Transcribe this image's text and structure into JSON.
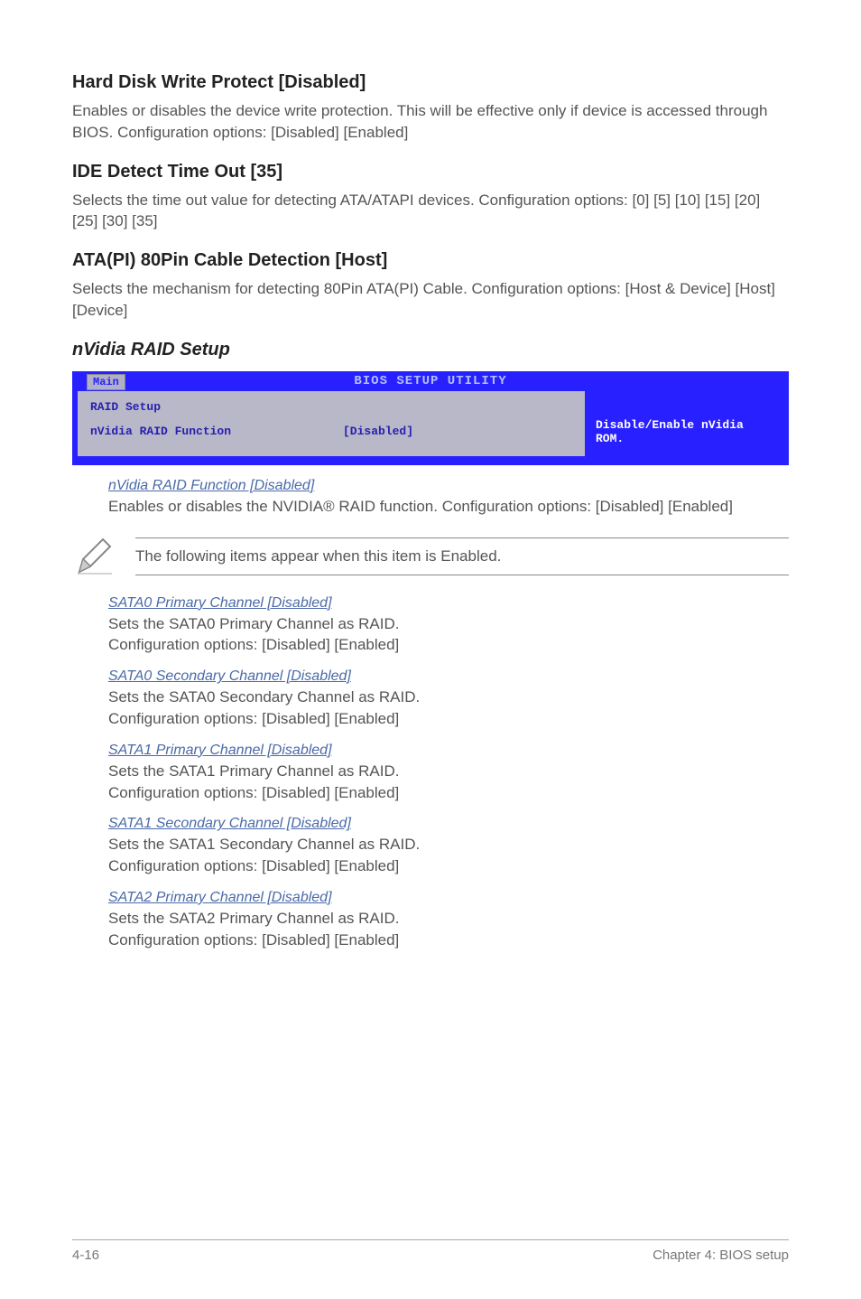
{
  "sections": {
    "s1": {
      "title": "Hard Disk Write Protect [Disabled]",
      "body": "Enables or disables the device write protection. This will be effective only if device is accessed through BIOS. Configuration options: [Disabled] [Enabled]"
    },
    "s2": {
      "title": "IDE Detect Time Out [35]",
      "body": "Selects the time out value for detecting ATA/ATAPI devices. Configuration options: [0] [5] [10] [15] [20] [25] [30] [35]"
    },
    "s3": {
      "title": "ATA(PI) 80Pin Cable Detection [Host]",
      "body": "Selects the mechanism for detecting 80Pin ATA(PI) Cable. Configuration options: [Host & Device] [Host] [Device]"
    }
  },
  "nvidia_heading": "nVidia RAID Setup",
  "bios": {
    "title": "BIOS SETUP UTILITY",
    "tab": "Main",
    "left_row1": "RAID Setup",
    "left_row2_label": "nVidia RAID Function",
    "left_row2_value": "[Disabled]",
    "right_text": "Disable/Enable nVidia ROM."
  },
  "raid_func": {
    "title": "nVidia RAID Function  [Disabled]",
    "body": "Enables or disables the NVIDIA® RAID function. Configuration options: [Disabled] [Enabled]"
  },
  "note": "The following items appear when this item is Enabled.",
  "sata": {
    "i1": {
      "t": "SATA0 Primary Channel [Disabled]",
      "b1": "Sets the SATA0 Primary Channel as RAID.",
      "b2": "Configuration options: [Disabled] [Enabled]"
    },
    "i2": {
      "t": "SATA0 Secondary Channel [Disabled]",
      "b1": "Sets the SATA0 Secondary Channel as RAID.",
      "b2": "Configuration options: [Disabled] [Enabled]"
    },
    "i3": {
      "t": "SATA1 Primary Channel [Disabled]",
      "b1": "Sets the SATA1 Primary Channel as RAID.",
      "b2": "Configuration options: [Disabled] [Enabled]"
    },
    "i4": {
      "t": "SATA1 Secondary Channel [Disabled]",
      "b1": "Sets the SATA1 Secondary Channel as RAID.",
      "b2": "Configuration options: [Disabled] [Enabled]"
    },
    "i5": {
      "t": "SATA2 Primary Channel [Disabled]",
      "b1": "Sets the SATA2 Primary Channel as RAID.",
      "b2": "Configuration options: [Disabled] [Enabled]"
    }
  },
  "footer": {
    "left": "4-16",
    "right": "Chapter 4: BIOS setup"
  }
}
